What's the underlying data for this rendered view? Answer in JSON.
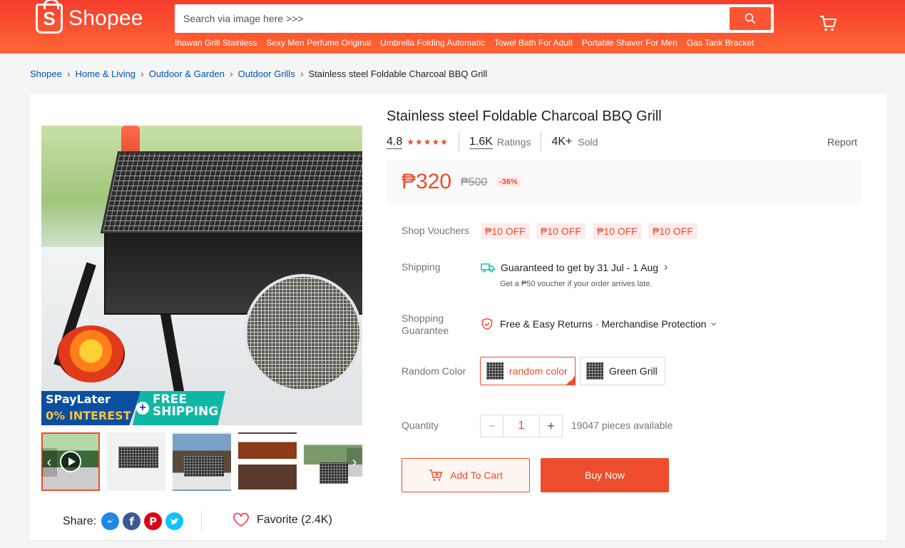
{
  "header": {
    "brand": "Shopee",
    "search_placeholder": "Search via image here >>>",
    "suggestions": [
      "Ihawan Grill Stainless",
      "Sexy Men Perfume Original",
      "Umbrella Folding Automatic",
      "Towel Bath For Adult",
      "Portable Shaver For Men",
      "Gas Tank Bracket"
    ]
  },
  "breadcrumb": [
    "Shopee",
    "Home & Living",
    "Outdoor & Garden",
    "Outdoor Grills",
    "Stainless steel Foldable Charcoal BBQ Grill"
  ],
  "promo": {
    "spay_top": "SPayLater",
    "spay_bottom": "0% INTEREST",
    "free": "FREE SHIPPING"
  },
  "share": {
    "label": "Share:"
  },
  "favorite": {
    "label": "Favorite (2.4K)"
  },
  "product": {
    "title": "Stainless steel Foldable Charcoal BBQ Grill",
    "rating": "4.8",
    "stars": "★★★★★",
    "ratings_count": "1.6K",
    "ratings_label": "Ratings",
    "sold_count": "4K+",
    "sold_label": "Sold",
    "report": "Report",
    "price": "₱320",
    "old_price": "₱500",
    "discount": "-36%"
  },
  "vouchers": {
    "label": "Shop Vouchers",
    "items": [
      "₱10 OFF",
      "₱10 OFF",
      "₱10 OFF",
      "₱10 OFF"
    ]
  },
  "shipping": {
    "label": "Shipping",
    "main": "Guaranteed to get by 31 Jul - 1 Aug",
    "sub": "Get a ₱50 voucher if your order arrives late."
  },
  "guarantee": {
    "label_line1": "Shopping",
    "label_line2": "Guarantee",
    "text": "Free & Easy Returns · Merchandise Protection"
  },
  "variation": {
    "label": "Random Color",
    "options": [
      "random color",
      "Green Grill"
    ]
  },
  "quantity": {
    "label": "Quantity",
    "value": "1",
    "available": "19047 pieces available"
  },
  "actions": {
    "add_to_cart": "Add To Cart",
    "buy_now": "Buy Now"
  },
  "colors": {
    "primary": "#ee4d2d",
    "header_top": "#f53d2d",
    "header_bottom": "#ff6633"
  }
}
